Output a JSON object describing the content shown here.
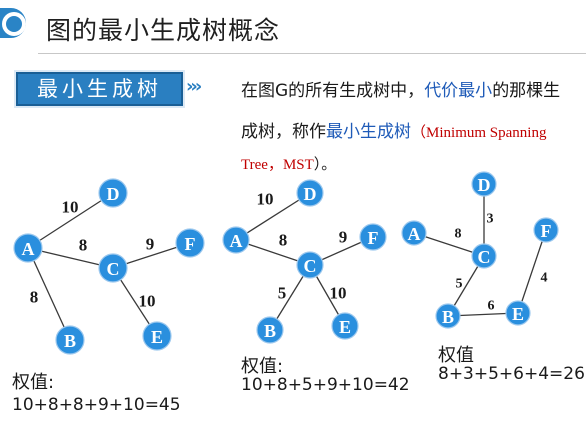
{
  "header": {
    "title": "图的最小生成树概念"
  },
  "definition": {
    "tag": "最小生成树",
    "chevrons": "›››",
    "line1_a": "在图G的所有生成树中，",
    "line1_b": "代价最小",
    "line1_c": "的那棵生",
    "line2_a": "成树，称作",
    "line2_b": "最小生成树",
    "line2_c": "（",
    "line2_d": "Minimum Spanning",
    "line3_a": "Tree，MST",
    "line3_b": "）。"
  },
  "graphs": [
    {
      "nodes": [
        "D",
        "A",
        "F",
        "C",
        "B",
        "E"
      ],
      "edges": [
        {
          "from": "A",
          "to": "D",
          "weight": "10"
        },
        {
          "from": "A",
          "to": "C",
          "weight": "8"
        },
        {
          "from": "C",
          "to": "F",
          "weight": "9"
        },
        {
          "from": "C",
          "to": "E",
          "weight": "10"
        },
        {
          "from": "A",
          "to": "B",
          "weight": "8"
        }
      ],
      "sum_label": "权值:",
      "sum_expr": "10+8+8+9+10=45"
    },
    {
      "nodes": [
        "D",
        "A",
        "F",
        "C",
        "B",
        "E"
      ],
      "edges": [
        {
          "from": "A",
          "to": "D",
          "weight": "10"
        },
        {
          "from": "A",
          "to": "C",
          "weight": "8"
        },
        {
          "from": "C",
          "to": "F",
          "weight": "9"
        },
        {
          "from": "C",
          "to": "B",
          "weight": "5"
        },
        {
          "from": "C",
          "to": "E",
          "weight": "10"
        }
      ],
      "sum_label": "权值:",
      "sum_expr": "10+8+5+9+10=42"
    },
    {
      "nodes": [
        "D",
        "A",
        "F",
        "C",
        "B",
        "E"
      ],
      "edges": [
        {
          "from": "A",
          "to": "C",
          "weight": "8"
        },
        {
          "from": "D",
          "to": "C",
          "weight": "3"
        },
        {
          "from": "C",
          "to": "B",
          "weight": "5"
        },
        {
          "from": "B",
          "to": "E",
          "weight": "6"
        },
        {
          "from": "E",
          "to": "F",
          "weight": "4"
        }
      ],
      "sum_label": "权值",
      "sum_expr": "8+3+5+6+4=26"
    }
  ],
  "colors": {
    "accent": "#2a84c6",
    "node": "#2a8fde",
    "highlight_blue": "#1f5bb8",
    "highlight_red": "#c00000"
  }
}
